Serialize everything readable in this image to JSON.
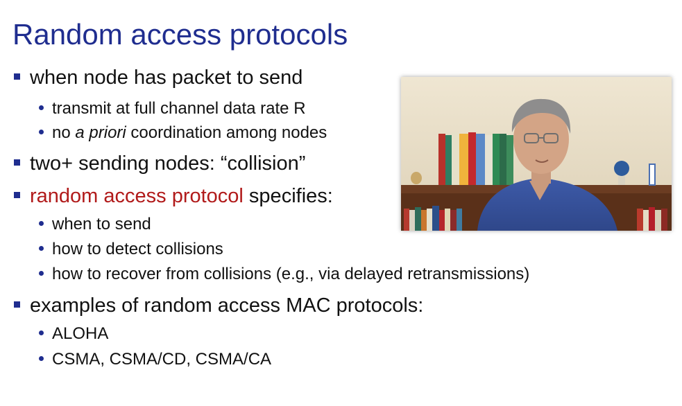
{
  "slide": {
    "title": "Random access protocols",
    "bullets": {
      "b1": "when node has packet to send",
      "b1_s1": "transmit at full channel data rate R",
      "b1_s2_pre": "no ",
      "b1_s2_italic": "a priori",
      "b1_s2_post": " coordination among nodes",
      "b2": "two+  sending nodes: “collision”",
      "b3_accent": "random access protocol",
      "b3_rest": " specifies:",
      "b3_s1": "when to send",
      "b3_s2": "how to detect collisions",
      "b3_s3": "how to recover from collisions (e.g., via delayed retransmissions)",
      "b4": "examples of random access MAC protocols:",
      "b4_s1": "ALOHA",
      "b4_s2": "CSMA, CSMA/CD, CSMA/CA"
    }
  },
  "colors": {
    "title": "#1f2d8f",
    "bullet_marker": "#1f2d8f",
    "accent": "#b11a1a",
    "text": "#111111"
  },
  "icons": {
    "level1_marker": "square-bullet-icon",
    "level2_marker": "round-bullet-icon"
  }
}
